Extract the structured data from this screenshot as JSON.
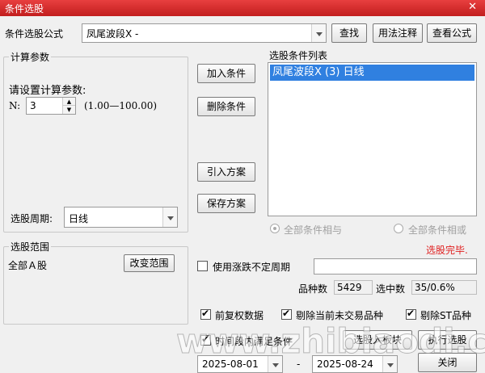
{
  "window": {
    "title": "条件选股",
    "close_glyph": "✕"
  },
  "formula": {
    "label": "条件选股公式",
    "selected": "凤尾波段X  -",
    "find_button": "查找",
    "usage_button": "用法注释",
    "view_button": "查看公式"
  },
  "params": {
    "group_title": "计算参数",
    "prompt": "请设置计算参数:",
    "n_label": "N:",
    "n_value": "3",
    "n_range": "(1.00—100.00)",
    "period_label": "选股周期:",
    "period_value": "日线"
  },
  "actions": {
    "add_condition": "加入条件",
    "delete_condition": "删除条件",
    "import_scheme": "引入方案",
    "save_scheme": "保存方案"
  },
  "conditions": {
    "title": "选股条件列表",
    "items": [
      "凤尾波段X (3) 日线"
    ],
    "radio_and": "全部条件相与",
    "radio_or": "全部条件相或",
    "status": "选股完毕."
  },
  "range": {
    "group_title": "选股范围",
    "value": "全部Ａ股",
    "change_button": "改变范围"
  },
  "options": {
    "variable_period_label": "使用涨跌不定周期",
    "variable_period_checked": false,
    "variety_count_label": "品种数",
    "variety_count": "5429",
    "selected_label": "选中数",
    "selected_value": "35/0.6%",
    "forward_adjust_label": "前复权数据",
    "forward_adjust_checked": true,
    "exclude_untraded_label": "剔除当前未交易品种",
    "exclude_untraded_checked": true,
    "exclude_st_label": "剔除ST品种",
    "exclude_st_checked": true,
    "time_range_label": "时间段内满足条件",
    "time_range_checked": true
  },
  "bottom": {
    "to_block_button": "选股入板块",
    "run_button": "执行选股",
    "date_from": "2025-08-01",
    "date_sep": "-",
    "date_to": "2025-08-24",
    "close_button": "关闭"
  },
  "watermark": "www.zhibiaodi.com",
  "colors": {
    "title_bar": "#d32a2a",
    "selection": "#3080e0",
    "status_text": "#e02020"
  }
}
